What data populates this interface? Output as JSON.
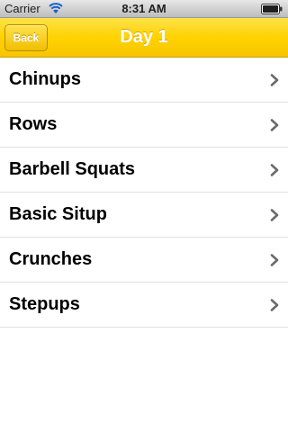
{
  "status_bar": {
    "carrier": "Carrier",
    "time": "8:31 AM",
    "wifi_icon": "wifi-icon",
    "battery_icon": "battery-icon"
  },
  "nav": {
    "back_label": "Back",
    "title": "Day 1",
    "accent_color": "#ffd200"
  },
  "rows": [
    {
      "label": "Chinups"
    },
    {
      "label": "Rows"
    },
    {
      "label": "Barbell Squats"
    },
    {
      "label": "Basic Situp"
    },
    {
      "label": "Crunches"
    },
    {
      "label": "Stepups"
    }
  ],
  "row_icon": "chevron-right-icon"
}
